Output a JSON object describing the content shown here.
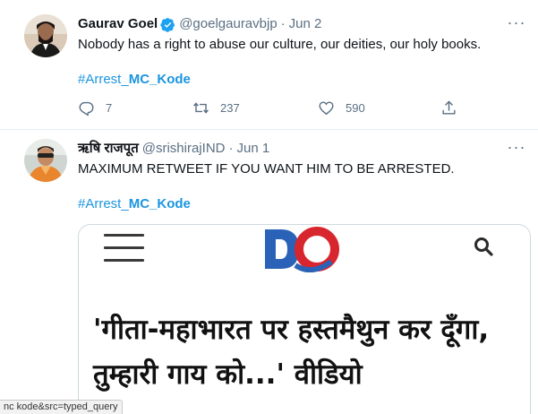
{
  "tweets": [
    {
      "author_name": "Gaurav Goel",
      "verified": true,
      "handle": "@goelgauravbjp",
      "separator": "·",
      "date": "Jun 2",
      "text": "Nobody has a right to abuse our culture, our deities, our holy books.",
      "hashtag_prefix": "#Arrest_",
      "hashtag_bold": "MC_Kode",
      "reply_count": "7",
      "retweet_count": "237",
      "like_count": "590",
      "more_icon": "more-dots-icon"
    },
    {
      "author_name": "ऋषि राजपूत",
      "verified": false,
      "handle": "@srishirajIND",
      "separator": "·",
      "date": "Jun 1",
      "text": "MAXIMUM RETWEET IF YOU WANT HIM TO BE ARRESTED.",
      "hashtag_prefix": "#Arrest_",
      "hashtag_bold": "MC_Kode",
      "more_icon": "more-dots-icon",
      "card": {
        "headline": "'गीता-महाभारत पर हस्तमैथुन कर दूँगा, तुम्हारी गाय को...' वीडियो",
        "icons": [
          "menu-icon",
          "site-logo",
          "search-icon"
        ]
      }
    }
  ],
  "status_bar": {
    "url_fragment": "nc kode&src=typed_query"
  },
  "colors": {
    "link": "#1b95e0",
    "secondary_text": "#5b7083",
    "verified_badge": "#1da1f2",
    "logo_blue": "#2a62b8",
    "logo_red": "#d8262e"
  }
}
